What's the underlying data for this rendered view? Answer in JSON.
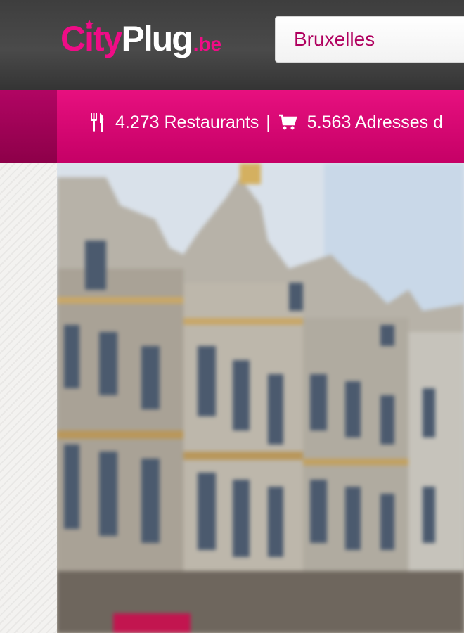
{
  "header": {
    "logo": {
      "city": "City",
      "plug": "Plug",
      "tld": ".be"
    },
    "city_selector": {
      "value": "Bruxelles"
    }
  },
  "stats": {
    "restaurants": "4.273 Restaurants",
    "separator": "|",
    "addresses": "5.563 Adresses d"
  },
  "icons": {
    "restaurants": "fork-knife-icon",
    "shopping": "shopping-cart-icon",
    "logo_star": "star-icon"
  },
  "colors": {
    "brand_pink": "#ef0c86",
    "header_dark": "#404040",
    "stats_band": "#d10070"
  }
}
